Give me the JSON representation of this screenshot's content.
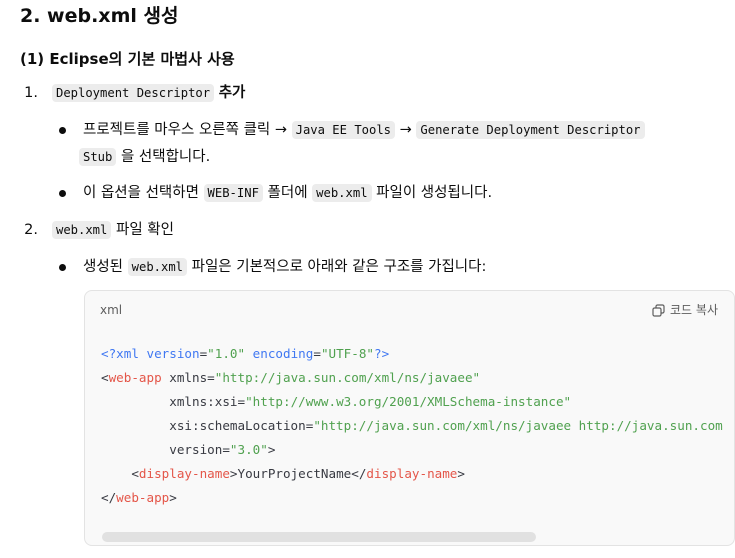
{
  "heading": "2. web.xml 생성",
  "subheading": "(1) Eclipse의 기본 마법사 사용",
  "step1": {
    "number": "1.",
    "code": "Deployment Descriptor",
    "suffix": "추가",
    "bullet1": {
      "part1": "프로젝트를 마우스 오른쪽 클릭 → ",
      "code1": "Java EE Tools",
      "part2": " → ",
      "code2": "Generate Deployment Descriptor",
      "code3": "Stub",
      "part3": " 을 선택합니다."
    },
    "bullet2": {
      "part1": "이 옵션을 선택하면 ",
      "code1": "WEB-INF",
      "part2": " 폴더에 ",
      "code2": "web.xml",
      "part3": " 파일이 생성됩니다."
    }
  },
  "step2": {
    "number": "2.",
    "code": "web.xml",
    "suffix": " 파일 확인",
    "bullet1": {
      "part1": "생성된 ",
      "code1": "web.xml",
      "part2": " 파일은 기본적으로 아래와 같은 구조를 가집니다:"
    }
  },
  "code_block": {
    "language": "xml",
    "copy_label": "코드 복사",
    "line1": {
      "a": "<?xml ",
      "b": "version",
      "c": "=",
      "d": "\"1.0\"",
      "e": " encoding",
      "f": "=",
      "g": "\"UTF-8\"",
      "h": "?>"
    },
    "line2": {
      "a": "<",
      "b": "web-app",
      "c": " xmlns",
      "d": "=",
      "e": "\"http://java.sun.com/xml/ns/javaee\""
    },
    "line3": {
      "a": "         xmlns:xsi",
      "b": "=",
      "c": "\"http://www.w3.org/2001/XMLSchema-instance\""
    },
    "line4": {
      "a": "         xsi:schemaLocation",
      "b": "=",
      "c": "\"http://java.sun.com/xml/ns/javaee http://java.sun.com"
    },
    "line5": {
      "a": "         version",
      "b": "=",
      "c": "\"3.0\"",
      "d": ">"
    },
    "line6": {
      "a": "    <",
      "b": "display-name",
      "c": ">YourProjectName</",
      "d": "display-name",
      "e": ">"
    },
    "line7": {
      "a": "</",
      "b": "web-app",
      "c": ">"
    }
  }
}
